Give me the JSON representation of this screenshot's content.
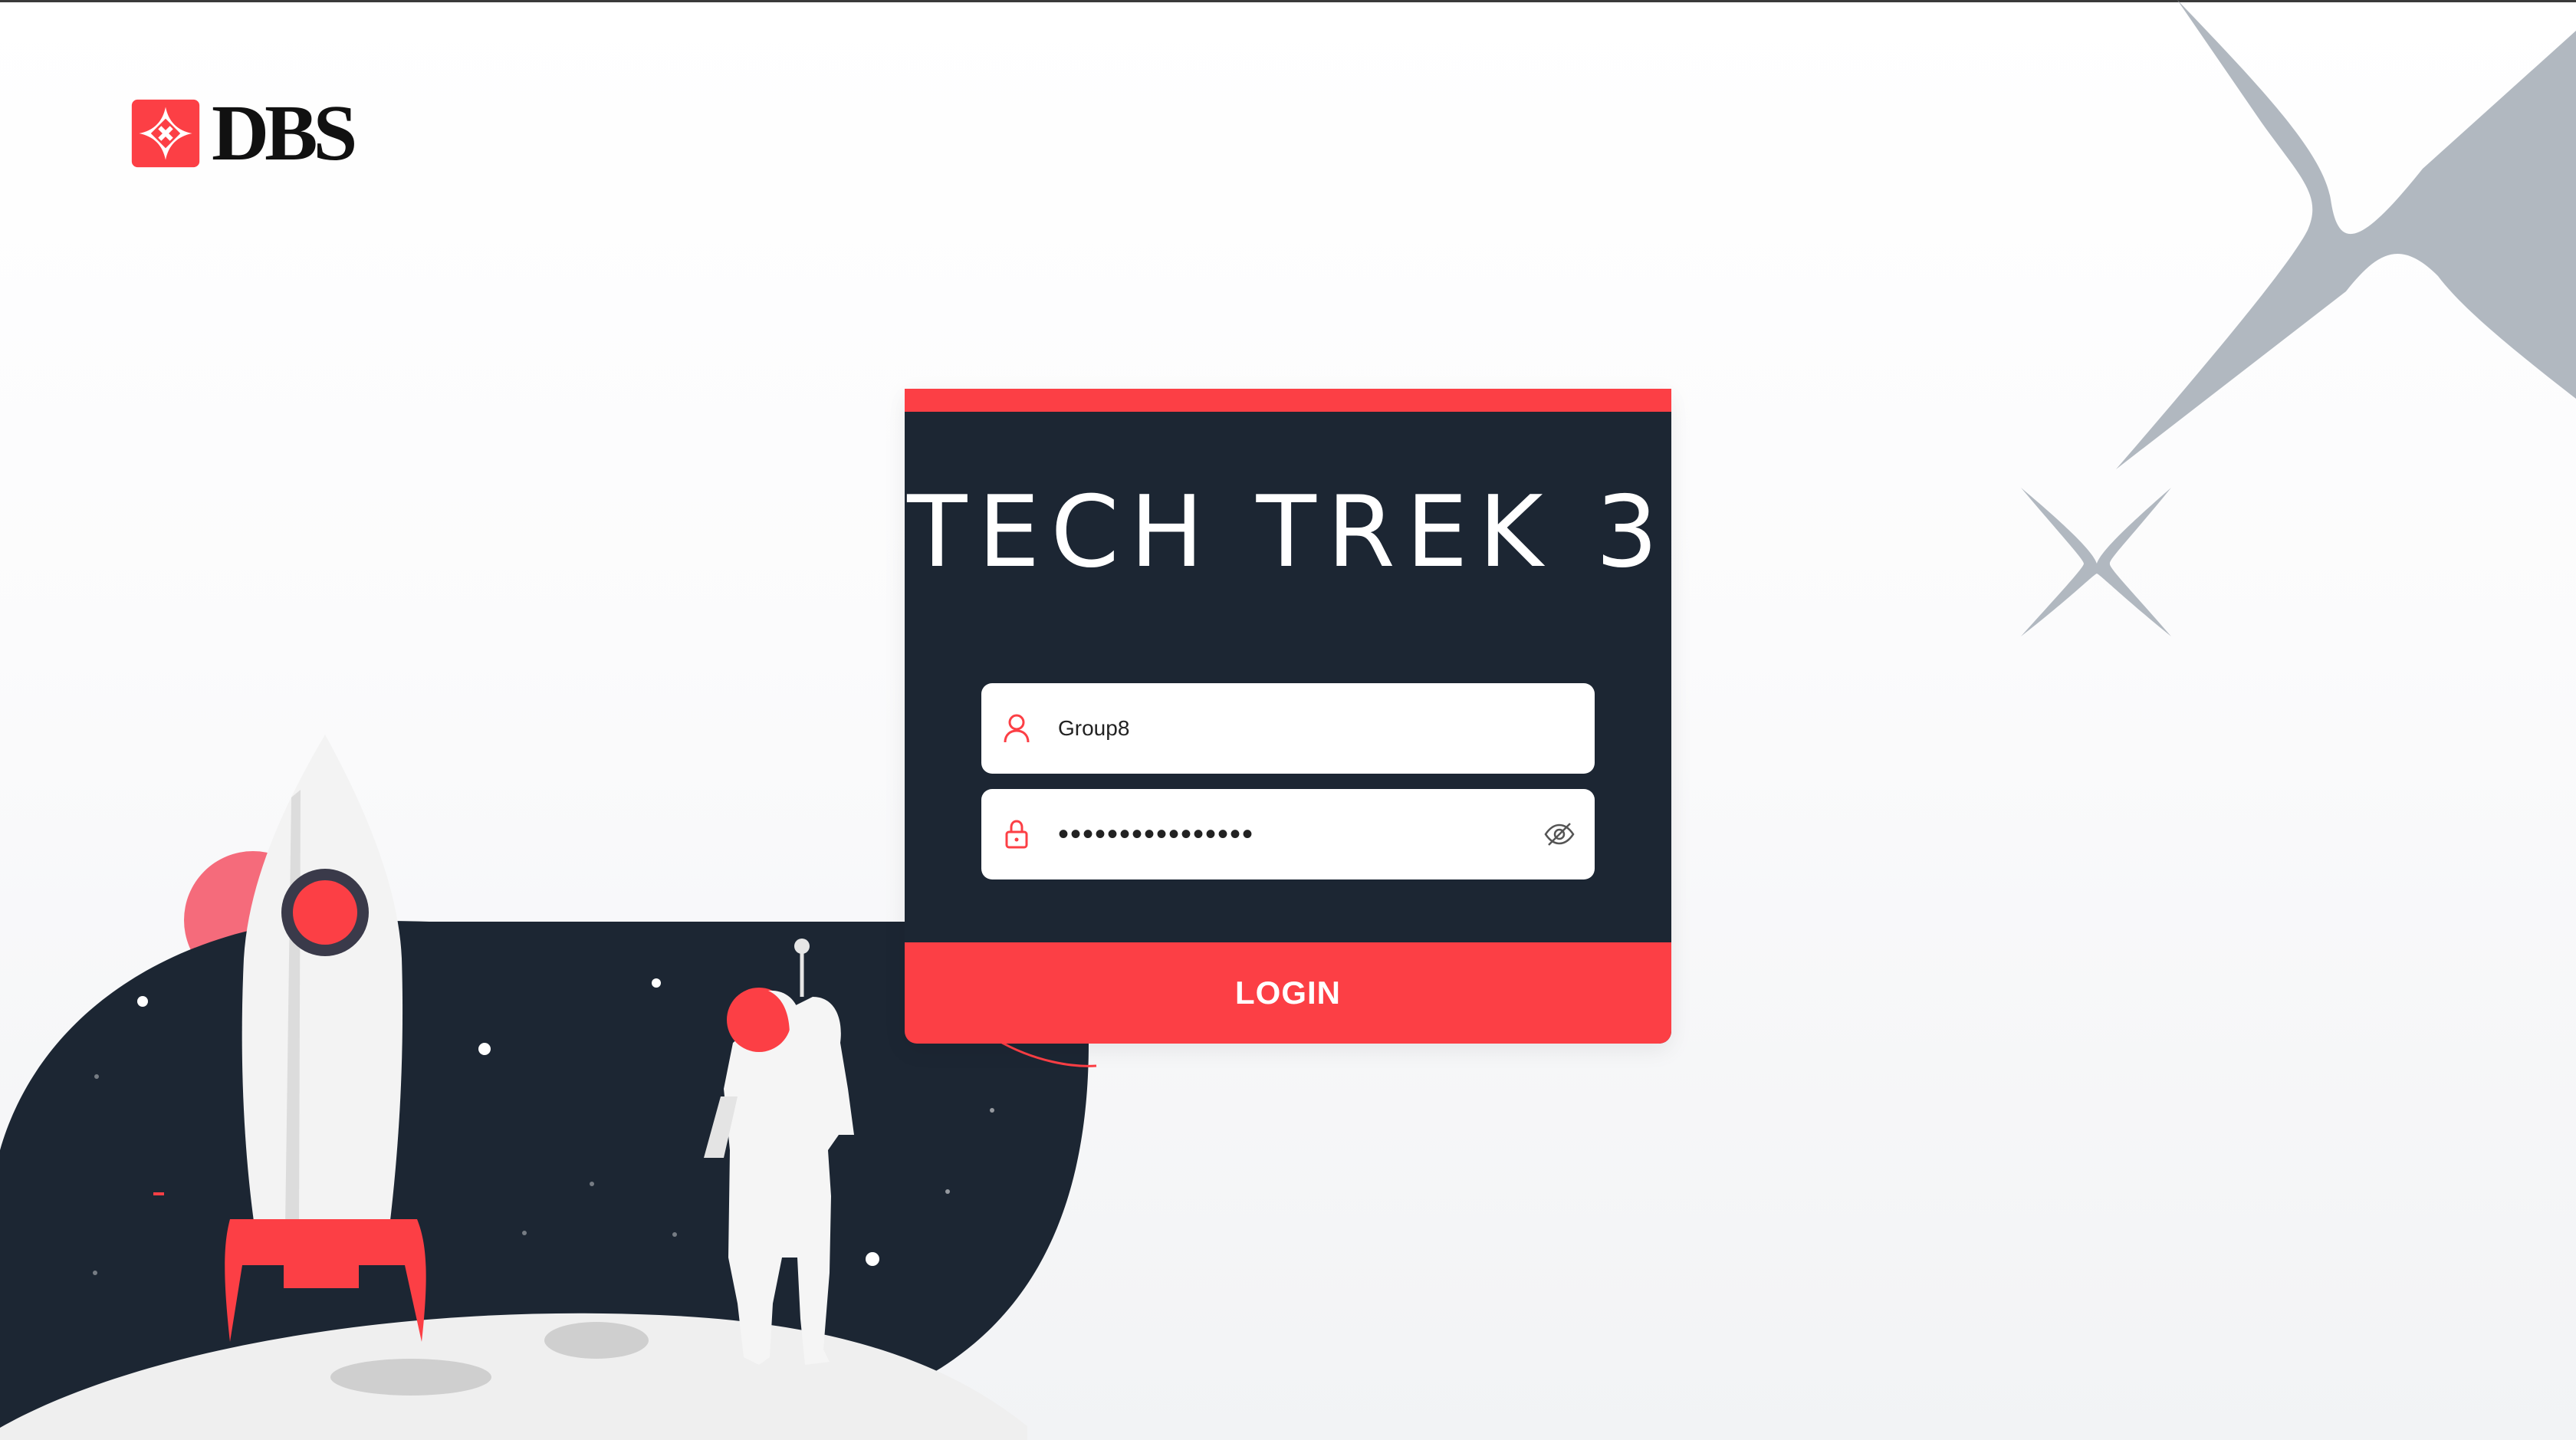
{
  "brand": {
    "logo_text": "DBS",
    "accent": "#fc3f45",
    "dark": "#1c2633",
    "star_color": "#b1b8c0"
  },
  "login": {
    "title": "TECH TREK 3",
    "username": {
      "value": "Group8",
      "icon": "user-icon"
    },
    "password": {
      "masked_value": "••••••••••••••••",
      "icon": "lock-icon",
      "toggle_icon": "eye-off-icon"
    },
    "submit_label": "LOGIN"
  },
  "illustration": {
    "elements": [
      "rocket",
      "astronaut",
      "moon-surface",
      "planet",
      "stars"
    ]
  }
}
